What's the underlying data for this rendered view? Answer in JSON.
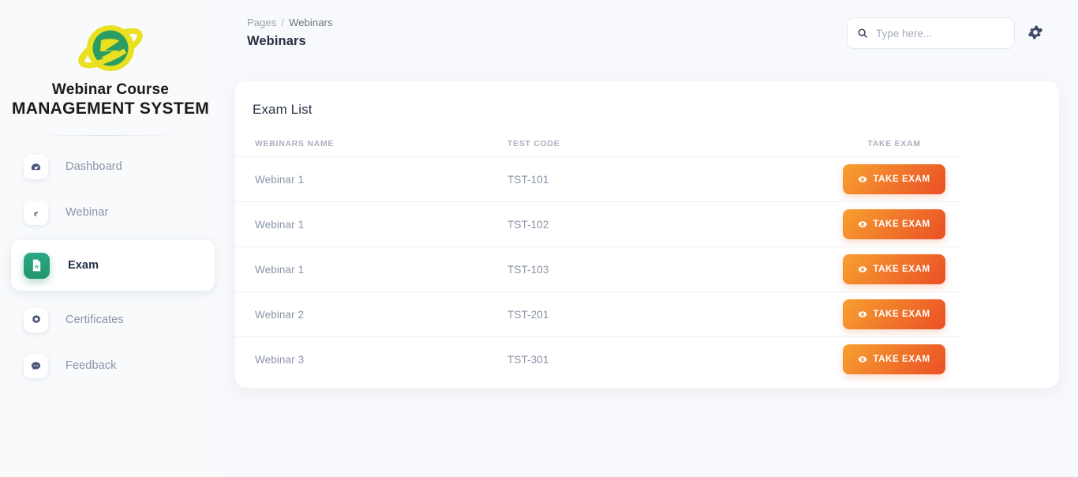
{
  "brand": {
    "line1": "Webinar Course",
    "line2": "MANAGEMENT SYSTEM",
    "logo_icon": "planet-icon",
    "logo_planet_color": "#2a9d62",
    "logo_ring_color": "#e9e021"
  },
  "sidebar": {
    "items": [
      {
        "label": "Dashboard",
        "icon": "gauge-icon",
        "active": false
      },
      {
        "label": "Webinar",
        "icon": "browser-e-icon",
        "active": false
      },
      {
        "label": "Exam",
        "icon": "document-w-icon",
        "active": true
      },
      {
        "label": "Certificates",
        "icon": "award-seal-icon",
        "active": false
      },
      {
        "label": "Feedback",
        "icon": "chat-bubble-icon",
        "active": false
      }
    ],
    "active_bg": "#21956f"
  },
  "topbar": {
    "breadcrumb_root": "Pages",
    "breadcrumb_sep": "/",
    "breadcrumb_current": "Webinars",
    "page_title": "Webinars",
    "search_placeholder": "Type here...",
    "search_value": "",
    "search_icon": "search-icon",
    "settings_icon": "gear-icon"
  },
  "card": {
    "title": "Exam List",
    "columns": {
      "name": "WEBINARS NAME",
      "code": "TEST CODE",
      "take": "TAKE EXAM"
    },
    "action_label": "TAKE EXAM",
    "action_icon": "eye-icon",
    "action_gradient_from": "#f7a030",
    "action_gradient_to": "#ea4f25",
    "rows": [
      {
        "name": "Webinar 1",
        "code": "TST-101",
        "action": "TAKE EXAM"
      },
      {
        "name": "Webinar 1",
        "code": "TST-102",
        "action": "TAKE EXAM"
      },
      {
        "name": "Webinar 1",
        "code": "TST-103",
        "action": "TAKE EXAM"
      },
      {
        "name": "Webinar 2",
        "code": "TST-201",
        "action": "TAKE EXAM"
      },
      {
        "name": "Webinar 3",
        "code": "TST-301",
        "action": "TAKE EXAM"
      }
    ]
  }
}
